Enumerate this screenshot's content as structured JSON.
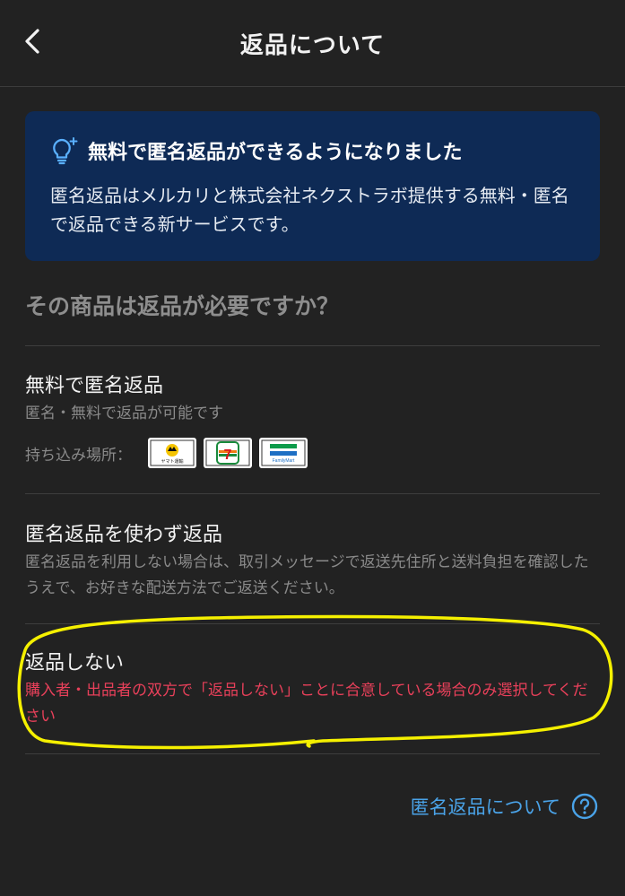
{
  "header": {
    "title": "返品について",
    "back_icon": "chevron-left-icon"
  },
  "banner": {
    "icon": "lightbulb-sparkle-icon",
    "title": "無料で匿名返品ができるようになりました",
    "body": "匿名返品はメルカリと株式会社ネクストラボ提供する無料・匿名で返品できる新サービスです。"
  },
  "question": "その商品は返品が必要ですか？",
  "options": [
    {
      "title": "無料で匿名返品",
      "subtitle": "匿名・無料で返品が可能です",
      "store_label": "持ち込み場所：",
      "stores": [
        {
          "name": "yamato-logo",
          "text": "ヤマト運輸"
        },
        {
          "name": "seven-eleven-logo",
          "text": "7"
        },
        {
          "name": "familymart-logo",
          "text": "FamilyMart"
        }
      ]
    },
    {
      "title": "匿名返品を使わず返品",
      "subtitle": "匿名返品を利用しない場合は、取引メッセージで返送先住所と送料負担を確認したうえで、お好きな配送方法でご返送ください。"
    },
    {
      "title": "返品しない",
      "warning": "購入者・出品者の双方で「返品しない」ことに合意している場合のみ選択してください"
    }
  ],
  "help_link": {
    "label": "匿名返品について",
    "icon": "question-circle-icon"
  },
  "colors": {
    "background": "#222222",
    "banner": "#0e2a55",
    "link": "#4aa3e8",
    "warning": "#e8405a",
    "annotation": "#f5f000"
  }
}
